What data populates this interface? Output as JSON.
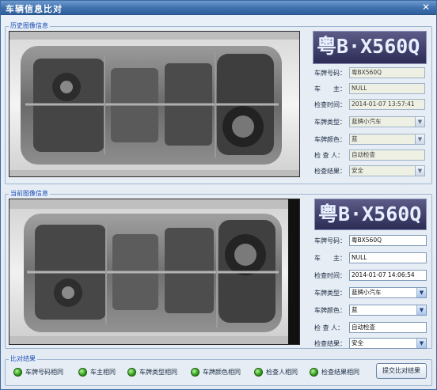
{
  "window": {
    "title": "车辆信息比对",
    "close_label": "✕"
  },
  "history": {
    "group_title": "历史图像信息",
    "plate_text": "粤B·X560Q",
    "fields": [
      {
        "label": "车牌号码：",
        "value": "粤BX560Q"
      },
      {
        "label": "车　　主：",
        "value": "NULL"
      },
      {
        "label": "检查时间：",
        "value": "2014-01-07 13:57:41"
      },
      {
        "label": "车牌类型：",
        "value": "蓝牌小汽车"
      },
      {
        "label": "车牌颜色：",
        "value": "蓝"
      },
      {
        "label": "检 查 人：",
        "value": "自动检查"
      },
      {
        "label": "检查结果：",
        "value": "安全"
      }
    ]
  },
  "current": {
    "group_title": "当前图像信息",
    "plate_text": "粤B·X560Q",
    "fields": [
      {
        "label": "车牌号码：",
        "value": "粤BX560Q"
      },
      {
        "label": "车　　主：",
        "value": "NULL"
      },
      {
        "label": "检查时间：",
        "value": "2014-01-07 14:06:54"
      },
      {
        "label": "车牌类型：",
        "value": "蓝牌小汽车"
      },
      {
        "label": "车牌颜色：",
        "value": "蓝"
      },
      {
        "label": "检 查 人：",
        "value": "自动检查"
      },
      {
        "label": "检查结果：",
        "value": "安全"
      }
    ]
  },
  "comparison": {
    "group_title": "比对结果",
    "items": [
      {
        "label": "车牌号码相同"
      },
      {
        "label": "车主相同"
      },
      {
        "label": "车牌类型相同"
      },
      {
        "label": "车牌颜色相同"
      },
      {
        "label": "检查人相同"
      },
      {
        "label": "检查结果相同"
      }
    ],
    "submit_label": "提交比对结果"
  },
  "icons": {
    "close": "close-icon",
    "dropdown": "chevron-down-icon",
    "status": "green-check-dot-icon"
  },
  "colors": {
    "title_bar": "#3e70ad",
    "group_title": "#1d4fb8",
    "status_ok": "#2e9a17"
  }
}
